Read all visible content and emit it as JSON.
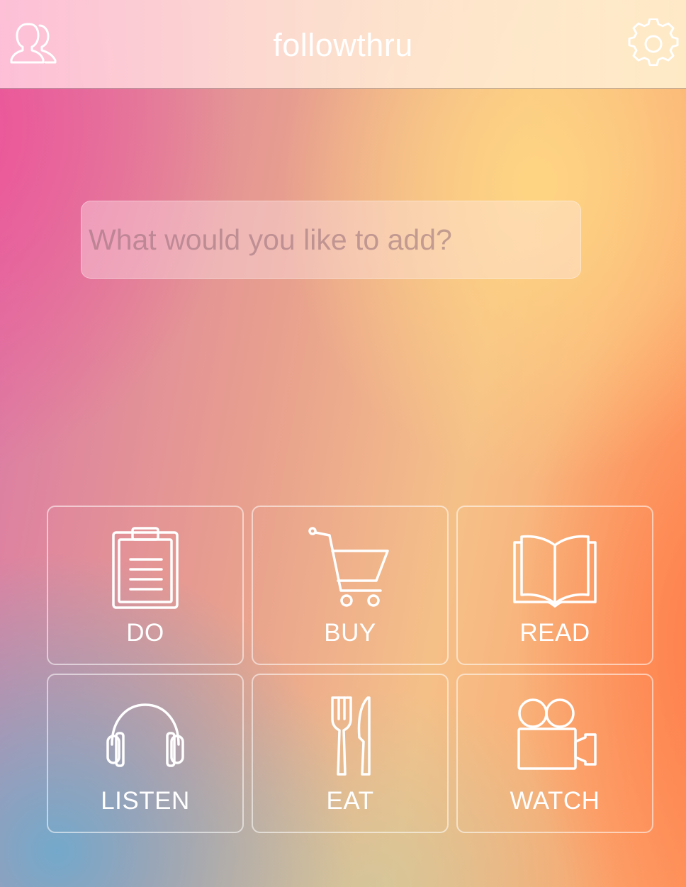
{
  "app": {
    "title": "followthru"
  },
  "header": {
    "left_icon": "friends-icon",
    "right_icon": "gear-icon"
  },
  "search": {
    "value": "",
    "placeholder": "What would you like to add?"
  },
  "categories": [
    {
      "label": "DO",
      "icon": "clipboard-icon"
    },
    {
      "label": "BUY",
      "icon": "cart-icon"
    },
    {
      "label": "READ",
      "icon": "book-icon"
    },
    {
      "label": "LISTEN",
      "icon": "headphones-icon"
    },
    {
      "label": "EAT",
      "icon": "fork-knife-icon"
    },
    {
      "label": "WATCH",
      "icon": "video-camera-icon"
    }
  ],
  "colors": {
    "foreground": "#ffffff",
    "header_bg": "#ffe6dc"
  }
}
